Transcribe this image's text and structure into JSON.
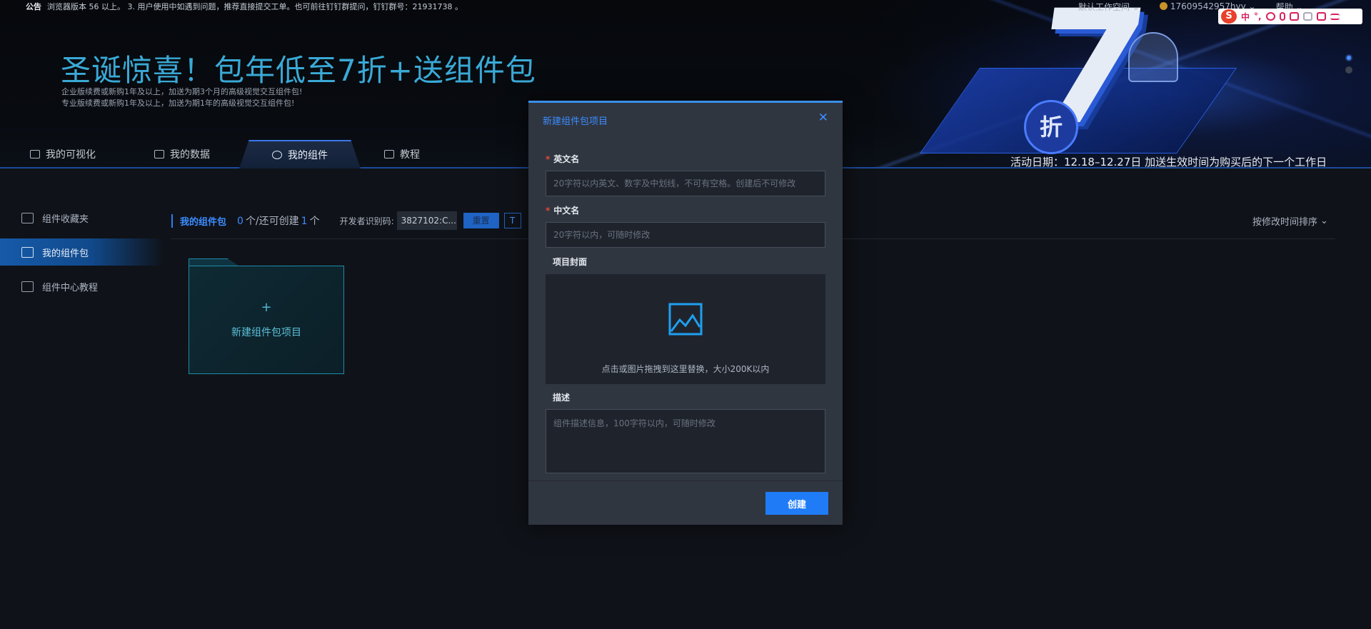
{
  "notice": {
    "label": "公告",
    "text": "浏览器版本 56 以上。 3. 用户使用中如遇到问题，推荐直接提交工单。也可前往钉钉群提问，钉钉群号：21931738 。"
  },
  "top_right": {
    "workspace": "默认工作空间",
    "account": "17609542957hyy",
    "help": "帮助"
  },
  "ime": {
    "logo": "S",
    "mode": "中",
    "punct": "°,"
  },
  "promo": {
    "title": "圣诞惊喜！包年低至7折+送组件包",
    "line1": "企业版续费或新购1年及以上，加送为期3个月的高级视觉交互组件包!",
    "line2": "专业版续费或新购1年及以上，加送为期1年的高级视觉交互组件包!",
    "art_text_seven": "7",
    "art_text_discount": "折",
    "activity": "活动日期：12.18–12.27日 加送生效时间为购买后的下一个工作日"
  },
  "main_tabs": [
    {
      "label": "我的可视化"
    },
    {
      "label": "我的数据"
    },
    {
      "label": "我的组件"
    },
    {
      "label": "教程"
    }
  ],
  "sidebar": {
    "items": [
      {
        "label": "组件收藏夹"
      },
      {
        "label": "我的组件包"
      },
      {
        "label": "组件中心教程"
      }
    ]
  },
  "toolbar": {
    "title": "我的组件包",
    "count": "0",
    "count_mid": "个/还可创建",
    "remaining": "1",
    "count_suffix": "个",
    "dev_label": "开发者识别码:",
    "dev_code": "3827102:C...",
    "reset_label": "重置",
    "other_label": "T",
    "sort_label": "按修改时间排序"
  },
  "card": {
    "plus": "+",
    "label": "新建组件包项目"
  },
  "modal": {
    "title": "新建组件包项目",
    "close": "✕",
    "en_name_label": "英文名",
    "en_name_placeholder": "20字符以内英文、数字及中划线，不可有空格。创建后不可修改",
    "cn_name_label": "中文名",
    "cn_name_placeholder": "20字符以内，可随时修改",
    "cover_label": "项目封面",
    "cover_hint": "点击或图片拖拽到这里替换，大小200K以内",
    "desc_label": "描述",
    "desc_placeholder": "组件描述信息，100字符以内，可随时修改",
    "required_mark": "*",
    "create_label": "创建"
  }
}
